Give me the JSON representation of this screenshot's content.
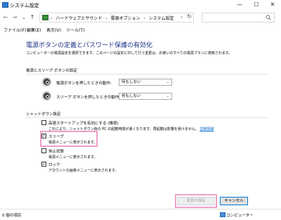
{
  "window": {
    "title": "システム設定",
    "minimize": "—",
    "maximize": "☐",
    "close": "✕"
  },
  "nav": {
    "back": "←",
    "forward": "→",
    "recent": "⌄",
    "up": "↑",
    "breadcrumb": [
      "ハードウェアとサウンド",
      "電源オプション",
      "システム設定"
    ],
    "separator": "›",
    "dropdown": "⌄",
    "refresh": "↻",
    "search_placeholder": ""
  },
  "menu": {
    "items": [
      "ファイル(F)",
      "編集(E)",
      "表示(V)",
      "ツール(T)"
    ]
  },
  "main": {
    "heading": "電源ボタンの定義とパスワード保護の有効化",
    "description": "コンピューターの電源設定を選択できます。このページの設定に対して行う変更は、お使いのすべての電源プランに適用されます。",
    "power_section": {
      "title": "電源とスリープ ボタンの設定",
      "power_button_label": "電源ボタンを押したときの動作:",
      "power_button_value": "何もしない",
      "sleep_button_label": "スリープ ボタンを押したときの動作:",
      "sleep_button_value": "何もしない"
    },
    "shutdown_section": {
      "title": "シャットダウン設定",
      "fast_startup_label": "高速スタートアップを有効にする (推奨)",
      "fast_startup_desc": "これにより、シャットダウン後の PC の起動時間が速くなります。再起動は影響を受けません。",
      "fast_startup_link": "詳細情報",
      "sleep_label": "スリープ",
      "sleep_desc": "電源メニューに表示されます。",
      "hibernate_label": "休止状態",
      "hibernate_desc": "電源メニューに表示されます。",
      "lock_label": "ロック",
      "lock_desc": "アカウントの画像メニューに表示されます。"
    },
    "checkboxes": {
      "fast_startup": false,
      "sleep": true,
      "hibernate": false,
      "lock": true
    },
    "check_mark": "✓"
  },
  "buttons": {
    "save": "変更の保存",
    "cancel": "キャンセル"
  },
  "status": {
    "items_count": "0 個の項目",
    "location": "コンピューター"
  },
  "colors": {
    "heading": "#1e3287",
    "link": "#0066cc",
    "highlight": "#f0a0c8"
  }
}
